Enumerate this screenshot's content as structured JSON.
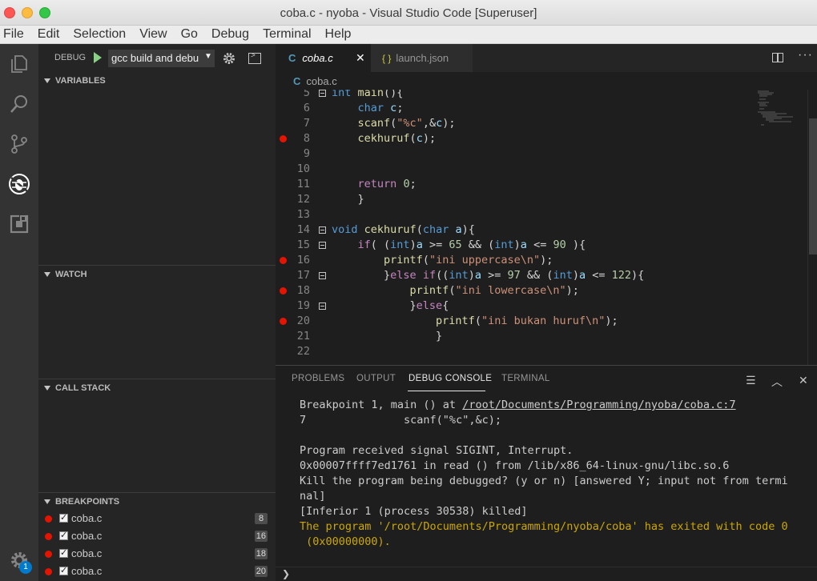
{
  "window": {
    "title": "coba.c - nyoba - Visual Studio Code [Superuser]"
  },
  "menu": [
    "File",
    "Edit",
    "Selection",
    "View",
    "Go",
    "Debug",
    "Terminal",
    "Help"
  ],
  "activity_bar": {
    "items": [
      "files-icon",
      "search-icon",
      "source-control-icon",
      "debug-icon",
      "extensions-icon"
    ],
    "manage_badge": "1"
  },
  "sidebar": {
    "debug_label": "DEBUG",
    "launch_config": "gcc build and debu",
    "sections": {
      "variables": "VARIABLES",
      "watch": "WATCH",
      "call_stack": "CALL STACK",
      "breakpoints": "BREAKPOINTS"
    },
    "breakpoints": [
      {
        "file": "coba.c",
        "line": "8"
      },
      {
        "file": "coba.c",
        "line": "16"
      },
      {
        "file": "coba.c",
        "line": "18"
      },
      {
        "file": "coba.c",
        "line": "20"
      }
    ]
  },
  "editor": {
    "tabs": [
      {
        "label": "coba.c",
        "icon": "C",
        "active": true
      },
      {
        "label": "launch.json",
        "icon": "{ }",
        "active": false
      }
    ],
    "breadcrumb": {
      "icon": "C",
      "file": "coba.c"
    },
    "line_numbers": [
      "5",
      "6",
      "7",
      "8",
      "9",
      "10",
      "11",
      "12",
      "13",
      "14",
      "15",
      "16",
      "17",
      "18",
      "19",
      "20",
      "21",
      "22"
    ],
    "breakpoint_lines": [
      "8",
      "16",
      "18",
      "20"
    ],
    "folded_lines": [
      "5",
      "14",
      "15",
      "17",
      "19"
    ]
  },
  "panel": {
    "tabs": [
      "PROBLEMS",
      "OUTPUT",
      "DEBUG CONSOLE",
      "TERMINAL"
    ],
    "active_tab": "DEBUG CONSOLE",
    "console": {
      "bp_prefix": "Breakpoint 1, main () at ",
      "bp_link": "/root/Documents/Programming/nyoba/coba.c:7",
      "lines": [
        "7               scanf(\"%c\",&c);",
        "",
        "Program received signal SIGINT, Interrupt.",
        "0x00007ffff7ed1761 in read () from /lib/x86_64-linux-gnu/libc.so.6",
        "Kill the program being debugged? (y or n) [answered Y; input not from termi",
        "nal]",
        "[Inferior 1 (process 30538) killed]"
      ],
      "exit_lines": [
        "The program '/root/Documents/Programming/nyoba/coba' has exited with code 0",
        " (0x00000000)."
      ]
    }
  }
}
